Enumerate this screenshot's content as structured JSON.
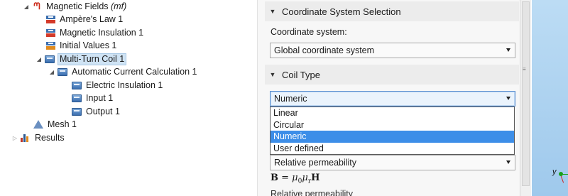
{
  "tree": {
    "magnetic_fields": {
      "label": "Magnetic Fields ",
      "tag": "(mf)"
    },
    "items": [
      {
        "label": "Ampère's Law 1"
      },
      {
        "label": "Magnetic Insulation 1"
      },
      {
        "label": "Initial Values 1"
      },
      {
        "label": "Multi-Turn Coil 1"
      },
      {
        "label": "Automatic Current Calculation 1"
      },
      {
        "label": "Electric Insulation 1"
      },
      {
        "label": "Input 1"
      },
      {
        "label": "Output 1"
      },
      {
        "label": "Mesh 1"
      },
      {
        "label": "Results"
      }
    ]
  },
  "settings": {
    "coordinate_section": {
      "title": "Coordinate System Selection",
      "field_label": "Coordinate system:",
      "value": "Global coordinate system"
    },
    "coil_section": {
      "title": "Coil Type",
      "value": "Numeric",
      "options": [
        "Linear",
        "Circular",
        "Numeric",
        "User defined"
      ],
      "selected_index": 2
    },
    "constitutive_value": "Relative permeability",
    "formula": {
      "lhs": "B",
      "eq": " = ",
      "mu": "μ",
      "sub0": "0",
      "mu2": "μ",
      "subr": "r",
      "rhs": "H"
    },
    "cutoff_label": "Relative permeability"
  },
  "graphics": {
    "axis_label": "y"
  },
  "colors": {
    "selection": "#3d8ee8",
    "tree_selected": "#cfe3f4",
    "graphics_bg": "#a9d0ef"
  }
}
